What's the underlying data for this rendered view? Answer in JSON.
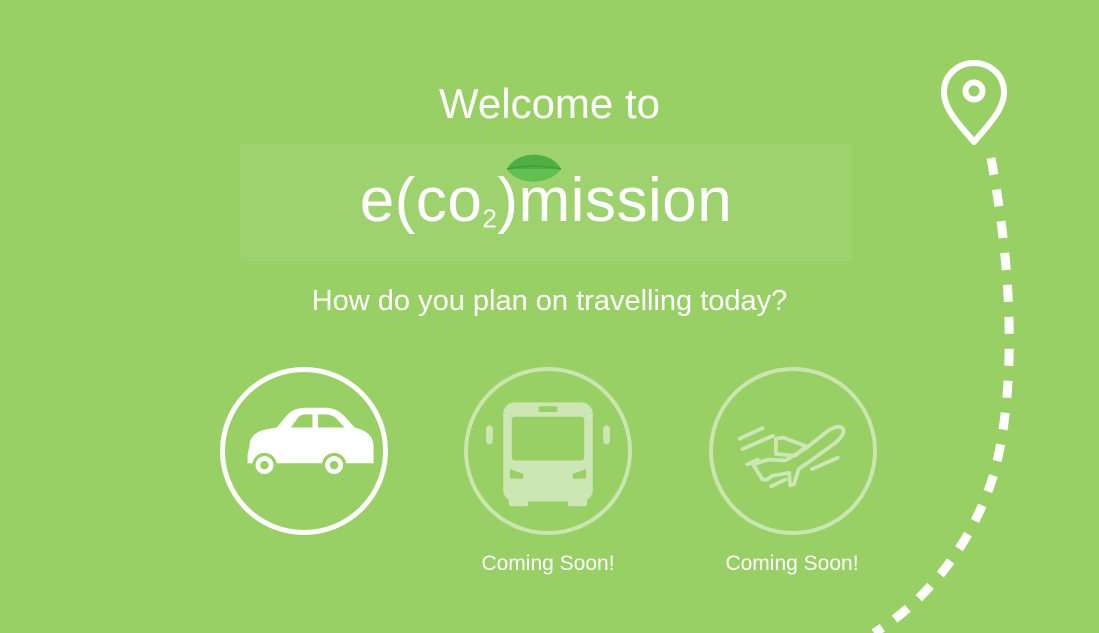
{
  "welcome_text": "Welcome to",
  "logo": {
    "prefix": "e(co",
    "subscript": "2",
    "suffix": ")mission"
  },
  "question_text": "How do you plan on travelling today?",
  "modes": [
    {
      "name": "car",
      "icon": "car-icon",
      "status": ""
    },
    {
      "name": "bus",
      "icon": "bus-icon",
      "status": "Coming Soon!"
    },
    {
      "name": "plane",
      "icon": "plane-icon",
      "status": "Coming Soon!"
    }
  ],
  "decor": {
    "pin_icon": "location-pin-icon",
    "route_icon": "dashed-route-icon"
  },
  "colors": {
    "background": "#98d066",
    "foreground": "#ffffff",
    "leaf_dark": "#3fa23a",
    "leaf_light": "#62bf52",
    "disabled_fill": "#cde7b4"
  }
}
